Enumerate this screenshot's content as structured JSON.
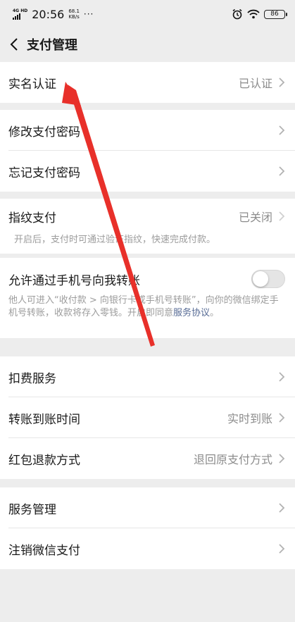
{
  "status_bar": {
    "network": "4G HD",
    "time": "20:56",
    "speed_value": "68.1",
    "speed_unit": "KB/s",
    "more": "···",
    "battery": "86",
    "icons": [
      "alarm-icon",
      "wifi-icon",
      "battery-icon"
    ]
  },
  "nav": {
    "title": "支付管理",
    "back_icon": "back-chevron-icon"
  },
  "groups": {
    "realname": {
      "label": "实名认证",
      "value": "已认证"
    },
    "password": [
      {
        "label": "修改支付密码"
      },
      {
        "label": "忘记支付密码"
      }
    ],
    "fingerprint": {
      "label": "指纹支付",
      "value": "已关闭",
      "desc": "开启后，支付时可通过验证指纹，快速完成付款。"
    },
    "phone_transfer": {
      "label": "允许通过手机号向我转账",
      "toggle_on": false,
      "desc_prefix": "他人可进入“收付款 > 向银行卡或手机号转账”，向你的微信绑定手机号转账，收款将存入零钱。开启即同意",
      "desc_link": "服务协议",
      "desc_suffix": "。"
    },
    "services": [
      {
        "label": "扣费服务",
        "value": ""
      },
      {
        "label": "转账到账时间",
        "value": "实时到账"
      },
      {
        "label": "红包退款方式",
        "value": "退回原支付方式"
      }
    ],
    "manage": [
      {
        "label": "服务管理"
      },
      {
        "label": "注销微信支付"
      }
    ]
  },
  "annotation": {
    "color": "#e8302a"
  }
}
